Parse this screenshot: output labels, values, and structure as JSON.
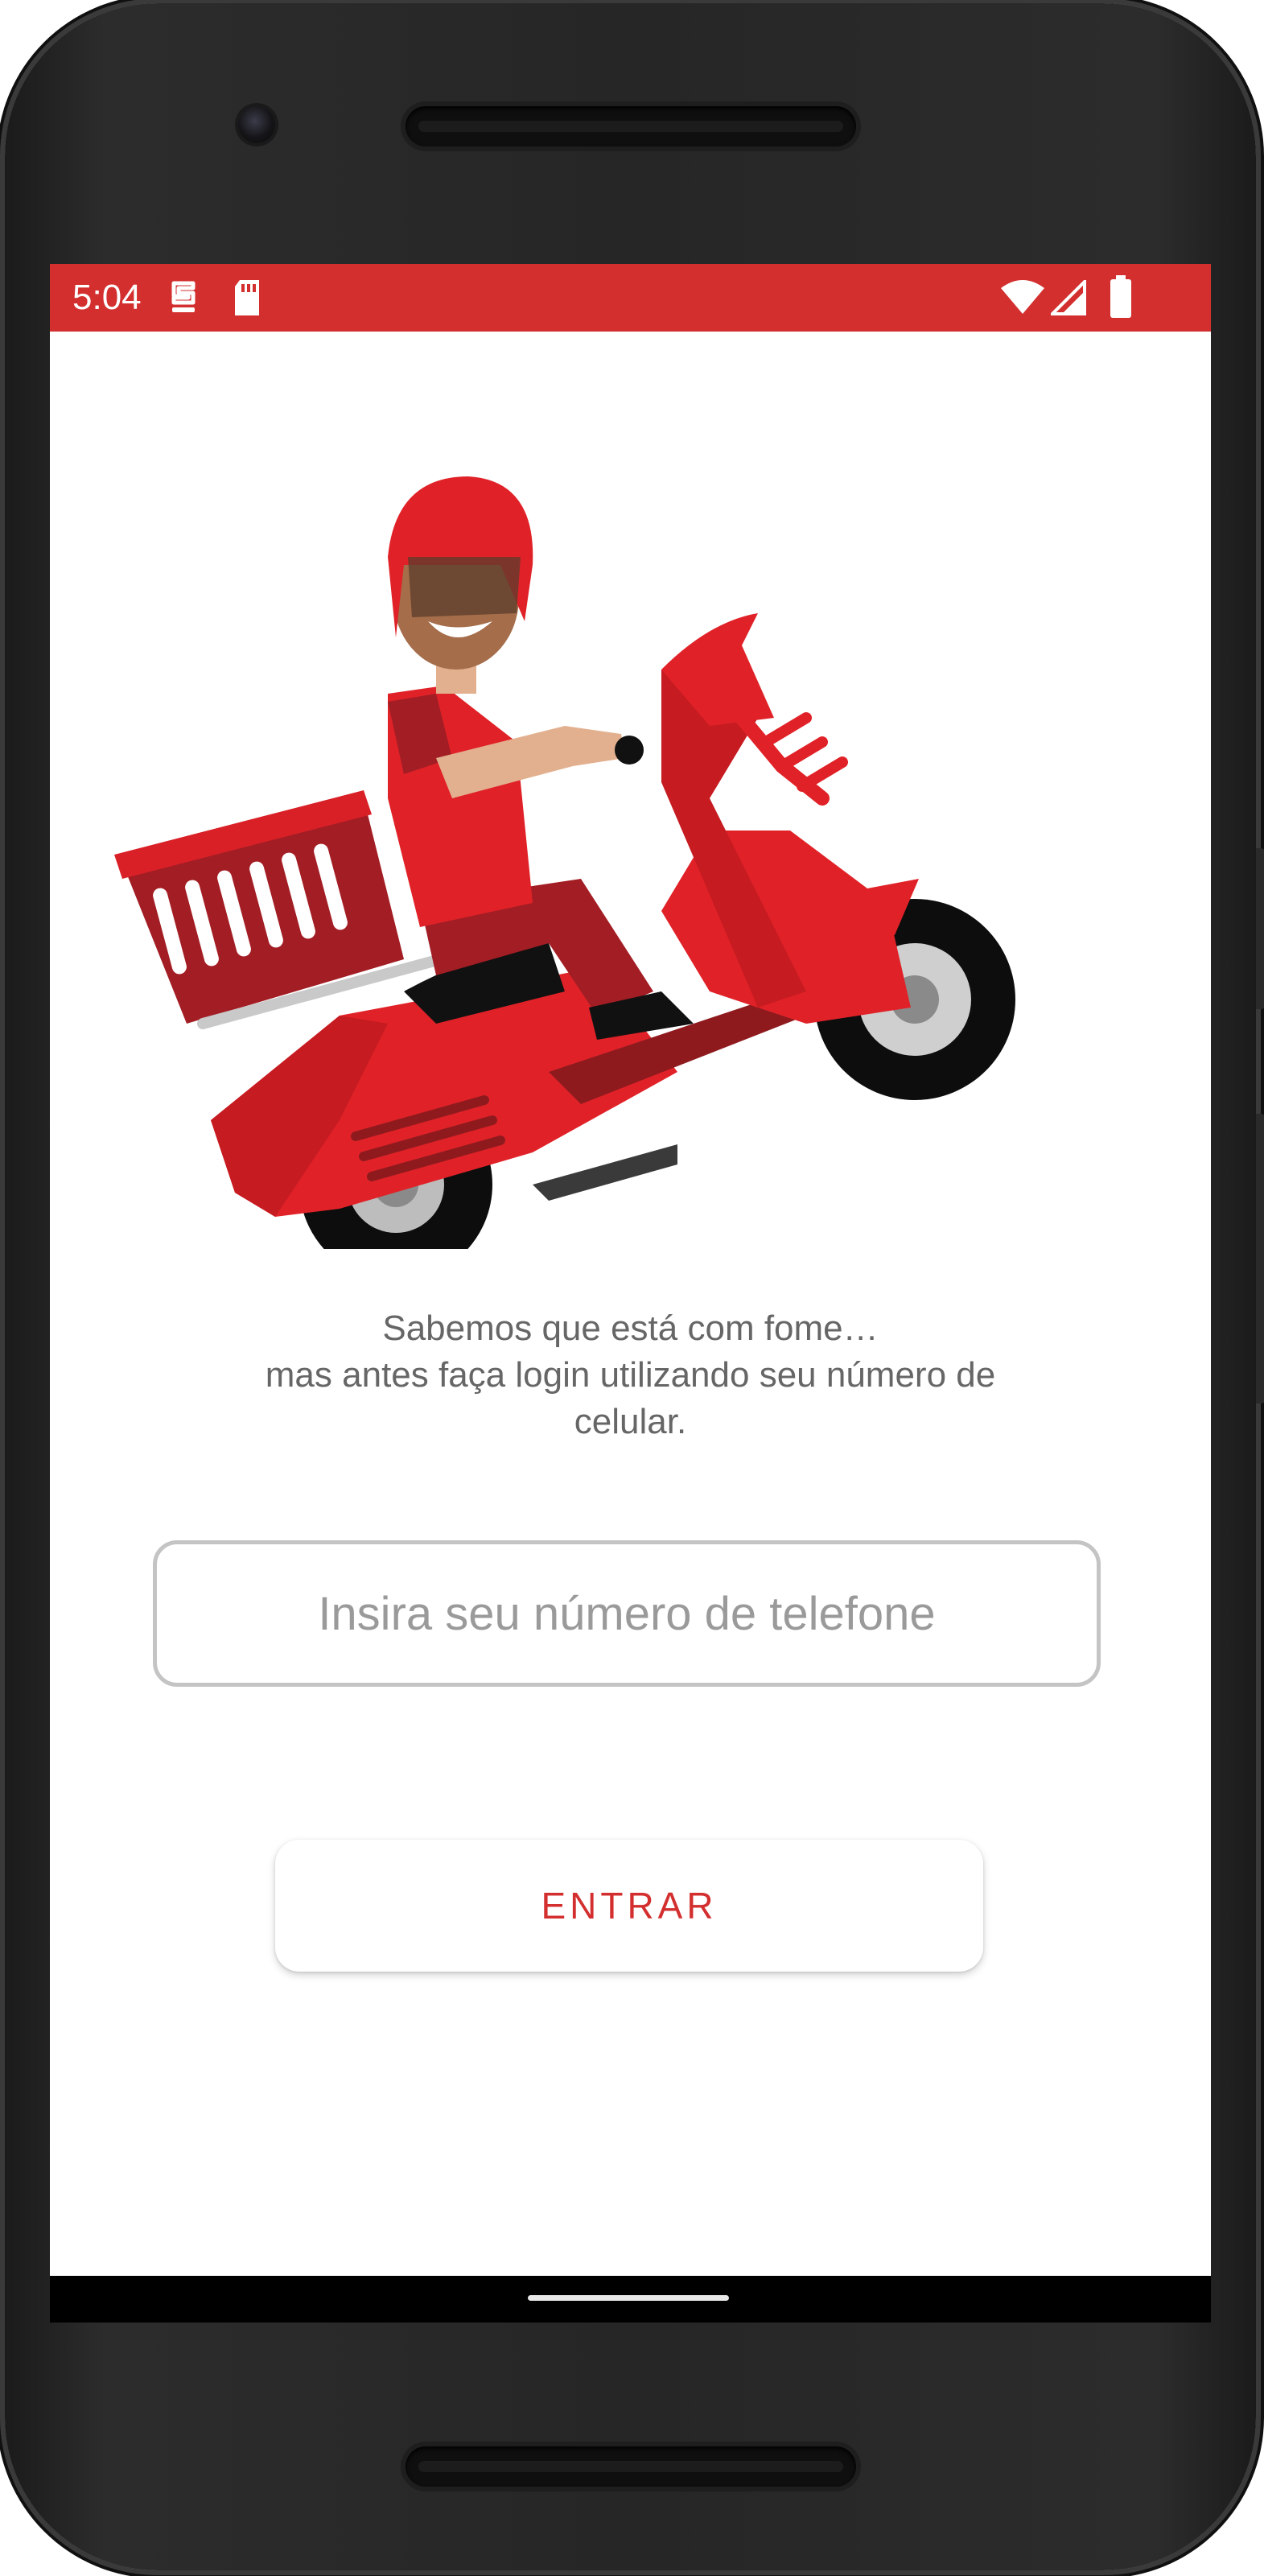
{
  "status_bar": {
    "time": "5:04",
    "background_color": "#d32f2f",
    "left_icons": [
      "notification-icon",
      "sd-card-icon"
    ],
    "right_icons": [
      "wifi-icon",
      "signal-icon",
      "battery-icon"
    ]
  },
  "illustration": {
    "icon": "delivery-scooter-illustration"
  },
  "message": {
    "line1": "Sabemos que está com fome…",
    "line2": "mas antes faça login utilizando seu número de",
    "line3": "celular."
  },
  "phone_input": {
    "value": "",
    "placeholder": "Insira seu número de telefone"
  },
  "enter_button": {
    "label": "ENTRAR",
    "color": "#d32f2f"
  }
}
